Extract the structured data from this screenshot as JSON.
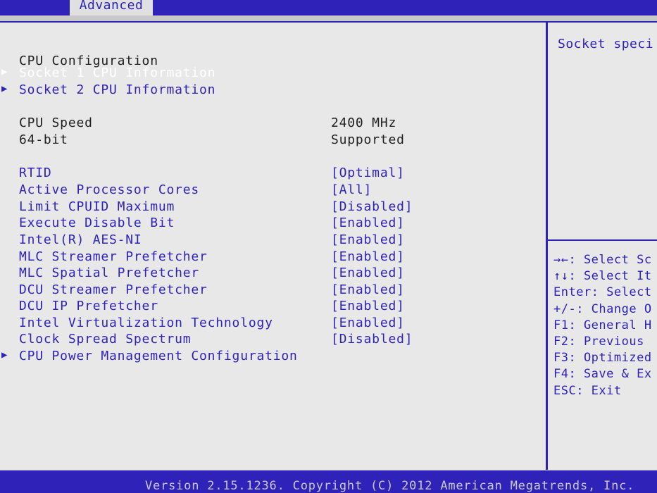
{
  "header": {
    "active_tab": "Advanced"
  },
  "page": {
    "title": "CPU Configuration"
  },
  "submenus": [
    {
      "label": "Socket 1 CPU Information",
      "arrow_icon": "triangle-right-icon"
    },
    {
      "label": "Socket 2 CPU Information",
      "arrow_icon": "triangle-right-icon"
    }
  ],
  "info": [
    {
      "label": "CPU Speed",
      "value": "2400 MHz"
    },
    {
      "label": "64-bit",
      "value": "Supported"
    }
  ],
  "settings": [
    {
      "label": "RTID",
      "value": "[Optimal]"
    },
    {
      "label": "Active Processor Cores",
      "value": "[All]"
    },
    {
      "label": "Limit CPUID Maximum",
      "value": "[Disabled]"
    },
    {
      "label": "Execute Disable Bit",
      "value": "[Enabled]"
    },
    {
      "label": "Intel(R) AES-NI",
      "value": "[Enabled]"
    },
    {
      "label": "MLC Streamer Prefetcher",
      "value": "[Enabled]"
    },
    {
      "label": "MLC Spatial Prefetcher",
      "value": "[Enabled]"
    },
    {
      "label": "DCU Streamer Prefetcher",
      "value": "[Enabled]"
    },
    {
      "label": "DCU IP Prefetcher",
      "value": "[Enabled]"
    },
    {
      "label": "Intel Virtualization Technology",
      "value": "[Enabled]"
    },
    {
      "label": "Clock Spread Spectrum",
      "value": "[Disabled]"
    }
  ],
  "bottom_submenu": {
    "label": "CPU Power Management Configuration",
    "arrow_icon": "triangle-right-icon"
  },
  "help": {
    "text": "Socket speci",
    "keys": [
      "→←: Select Sc",
      "↑↓: Select It",
      "Enter: Select",
      "+/-: Change O",
      "F1: General H",
      "F2: Previous",
      "F3: Optimized",
      "F4: Save & Ex",
      "ESC: Exit"
    ]
  },
  "footer": {
    "text": "Version 2.15.1236. Copyright (C) 2012 American Megatrends, Inc."
  },
  "colors": {
    "accent": "#2f22b8",
    "panel": "#e8e8e8",
    "selected_text": "#ffffff"
  }
}
